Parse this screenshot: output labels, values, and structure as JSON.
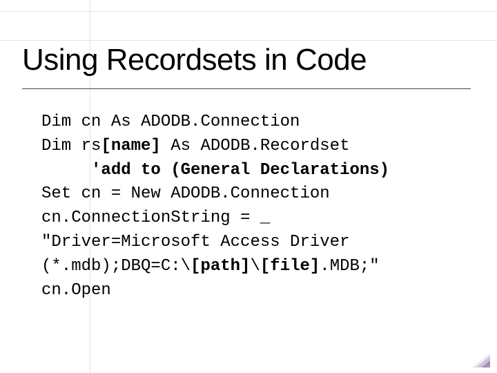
{
  "title": "Using Recordsets in Code",
  "code": {
    "l1": "Dim cn As ADODB.Connection",
    "l2_pre": "Dim rs",
    "l2_bold": "[name]",
    "l2_post": " As ADODB.Recordset",
    "l3_bold": "'add to (General Declarations)",
    "l4": "Set cn = New ADODB.Connection",
    "l5": "cn.ConnectionString = _ ",
    "l6": "\"Driver=Microsoft Access Driver ",
    "l7_pre": "(*.mdb);DBQ=C:\\",
    "l7_b1": "[path]",
    "l7_mid": "\\",
    "l7_b2": "[file]",
    "l7_post": ".MDB;\"",
    "l8": "cn.Open"
  }
}
